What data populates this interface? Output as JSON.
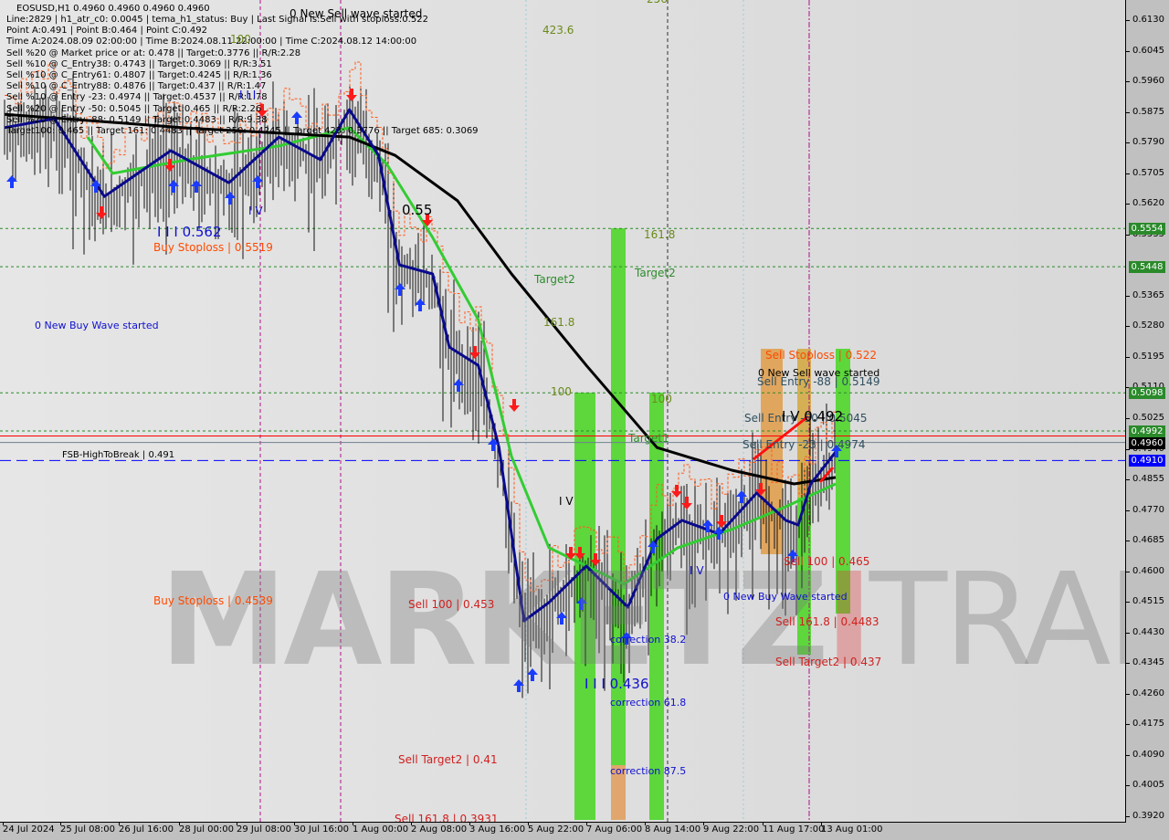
{
  "header": {
    "symbol_line": "EOSUSD,H1  0.4960 0.4960 0.4960 0.4960",
    "info_lines": [
      "Line:2829 | h1_atr_c0: 0.0045 | tema_h1_status: Buy | Last Signal is:Sell with stoploss:0.522",
      "Point A:0.491 | Point B:0.464 | Point C:0.492",
      "Time A:2024.08.09 02:00:00 | Time B:2024.08.11 22:00:00 | Time C:2024.08.12 14:00:00",
      "Sell %20 @ Market price or at: 0.478 || Target:0.3776 || R/R:2.28",
      "Sell %10 @ C_Entry38: 0.4743 || Target:0.3069 || R/R:3.51",
      "Sell %10 @ C_Entry61: 0.4807 || Target:0.4245 || R/R:1.36",
      "Sell %10 @ C_Entry88: 0.4876 || Target:0.437 || R/R:1.47",
      "Sell %10 @ Entry -23: 0.4974 || Target:0.4537 || R/R:1.78",
      "Sell %20 @ Entry -50: 0.5045 || Target:0.465 || R/R:2.26",
      "Sell %20 @ Entry -88: 0.5149 || Target:0.4483 || R/R:9.38",
      "Target100: 0.465 || Target 161: 0.4483 || Target 250: 0.4245 || Target 423: 0.3776 || Target 685: 0.3069"
    ]
  },
  "watermark": {
    "left": "MARKETZ",
    "mid": "I",
    "right": "TRADE"
  },
  "annotations": {
    "new_sell_top": "0 New Sell wave started",
    "fib_4236": "423.6",
    "fib_256": "256",
    "fib_100_top": "100",
    "wave_iii_top": "I I I",
    "wave_iv_left": "I V",
    "wave_iii_0562": "I I I 0.562",
    "buy_stoploss_05519": "Buy Stoploss | 0.5519",
    "new_buy_left": "0 New Buy Wave started",
    "level_055": "0.55",
    "target2_a": "Target2",
    "fib_1618_a": "161.8",
    "fib_1618_b": "161.8",
    "target2_b": "Target2",
    "fib_100_a": "100",
    "fib_100_b": "100",
    "target1": "Target1",
    "fsb": "FSB-HighToBreak | 0.491",
    "wave_iv_mid": "I V",
    "buy_stoploss_04539": "Buy Stoploss | 0.4539",
    "sell100_0453": "Sell 100 | 0.453",
    "corr_382": "correction 38.2",
    "wave_iii_0436": "I I I 0.436",
    "corr_618": "correction 61.8",
    "corr_875": "correction 87.5",
    "sell_target2_041": "Sell Target2 | 0.41",
    "sell_1618_bottom": "Sell 161.8 | 0.3931",
    "sell_stoploss_0522": "Sell Stoploss | 0.522",
    "new_sell_right": "0 New Sell wave started",
    "sell_entry_88": "Sell Entry -88 | 0.5149",
    "sell_entry_50": "Sell Entry -50 | 0.5045",
    "wave_iv_0492": "I V 0.492",
    "sell_entry_23": "Sell Entry -23 | 0.4974",
    "wave_iv_right": "I V",
    "sell100_0465": "Sell 100 | 0.465",
    "new_buy_right": "0 New Buy Wave started",
    "sell_1618_04483": "Sell 161.8 | 0.4483",
    "sell_target2_0437": "Sell Target2 | 0.437"
  },
  "chart_data": {
    "type": "line",
    "title": "EOSUSD,H1",
    "ylim": [
      0.392,
      0.613
    ],
    "y_ticks": [
      "0.6130",
      "0.6045",
      "0.5960",
      "0.5875",
      "0.5790",
      "0.5705",
      "0.5620",
      "0.5535",
      "0.5365",
      "0.5280",
      "0.5195",
      "0.5110",
      "0.5025",
      "0.4940",
      "0.4855",
      "0.4770",
      "0.4685",
      "0.4600",
      "0.4515",
      "0.4430",
      "0.4345",
      "0.4260",
      "0.4175",
      "0.4090",
      "0.4005",
      "0.3920"
    ],
    "x_ticks": [
      "24 Jul 2024",
      "25 Jul 08:00",
      "26 Jul 16:00",
      "28 Jul 00:00",
      "29 Jul 08:00",
      "30 Jul 16:00",
      "1 Aug 00:00",
      "2 Aug 08:00",
      "3 Aug 16:00",
      "5 Aug 22:00",
      "7 Aug 06:00",
      "8 Aug 14:00",
      "9 Aug 22:00",
      "11 Aug 17:00",
      "13 Aug 01:00"
    ],
    "price_badges": [
      {
        "value": "0.5554",
        "color": "#2a8a2a"
      },
      {
        "value": "0.5448",
        "color": "#2a8a2a"
      },
      {
        "value": "0.5098",
        "color": "#2a8a2a"
      },
      {
        "value": "0.4992",
        "color": "#2a8a2a"
      },
      {
        "value": "0.4960",
        "color": "#000000"
      },
      {
        "value": "0.4910",
        "color": "#0000ff"
      }
    ],
    "horizontal_levels": [
      {
        "price": 0.5554,
        "style": "dotted",
        "color": "#2a8a2a"
      },
      {
        "price": 0.5448,
        "style": "dotted",
        "color": "#2a8a2a"
      },
      {
        "price": 0.5098,
        "style": "dotted",
        "color": "#2a8a2a"
      },
      {
        "price": 0.4992,
        "style": "dotted",
        "color": "#2a8a2a"
      },
      {
        "price": 0.4978,
        "style": "solid",
        "color": "#ff0000"
      },
      {
        "price": 0.496,
        "style": "solid",
        "color": "#708090"
      },
      {
        "price": 0.491,
        "style": "dashed",
        "color": "#0000ff"
      }
    ],
    "series": [
      {
        "name": "tema",
        "color": "#0a0a8c",
        "points": [
          [
            0,
            0.5834
          ],
          [
            0.06,
            0.5859
          ],
          [
            0.12,
            0.5643
          ],
          [
            0.2,
            0.577
          ],
          [
            0.27,
            0.5681
          ],
          [
            0.33,
            0.5808
          ],
          [
            0.38,
            0.5745
          ],
          [
            0.415,
            0.5884
          ],
          [
            0.45,
            0.5757
          ],
          [
            0.475,
            0.5453
          ],
          [
            0.515,
            0.5428
          ],
          [
            0.535,
            0.5225
          ],
          [
            0.57,
            0.5174
          ],
          [
            0.595,
            0.4946
          ],
          [
            0.625,
            0.4465
          ],
          [
            0.655,
            0.4516
          ],
          [
            0.7,
            0.4617
          ],
          [
            0.75,
            0.4503
          ],
          [
            0.785,
            0.4693
          ],
          [
            0.815,
            0.4744
          ],
          [
            0.86,
            0.4706
          ],
          [
            0.905,
            0.482
          ],
          [
            0.94,
            0.4744
          ],
          [
            0.955,
            0.4731
          ],
          [
            0.97,
            0.4845
          ],
          [
            1.0,
            0.4934
          ]
        ]
      },
      {
        "name": "ma_slow",
        "color": "#000000",
        "points": [
          [
            0,
            0.5871
          ],
          [
            0.07,
            0.5859
          ],
          [
            0.22,
            0.5833
          ],
          [
            0.415,
            0.5808
          ],
          [
            0.47,
            0.5757
          ],
          [
            0.545,
            0.5631
          ],
          [
            0.61,
            0.5428
          ],
          [
            0.7,
            0.5174
          ],
          [
            0.785,
            0.4946
          ],
          [
            0.875,
            0.4883
          ],
          [
            0.95,
            0.4845
          ],
          [
            1.0,
            0.4863
          ]
        ]
      },
      {
        "name": "ma_mid",
        "color": "#33cc33",
        "points": [
          [
            0.1,
            0.5808
          ],
          [
            0.13,
            0.5707
          ],
          [
            0.22,
            0.5745
          ],
          [
            0.33,
            0.5783
          ],
          [
            0.415,
            0.5834
          ],
          [
            0.46,
            0.5732
          ],
          [
            0.515,
            0.5529
          ],
          [
            0.57,
            0.5301
          ],
          [
            0.61,
            0.4921
          ],
          [
            0.655,
            0.4668
          ],
          [
            0.745,
            0.4567
          ],
          [
            0.81,
            0.4668
          ],
          [
            0.875,
            0.4719
          ],
          [
            0.94,
            0.4782
          ],
          [
            1.0,
            0.4845
          ]
        ]
      }
    ]
  }
}
